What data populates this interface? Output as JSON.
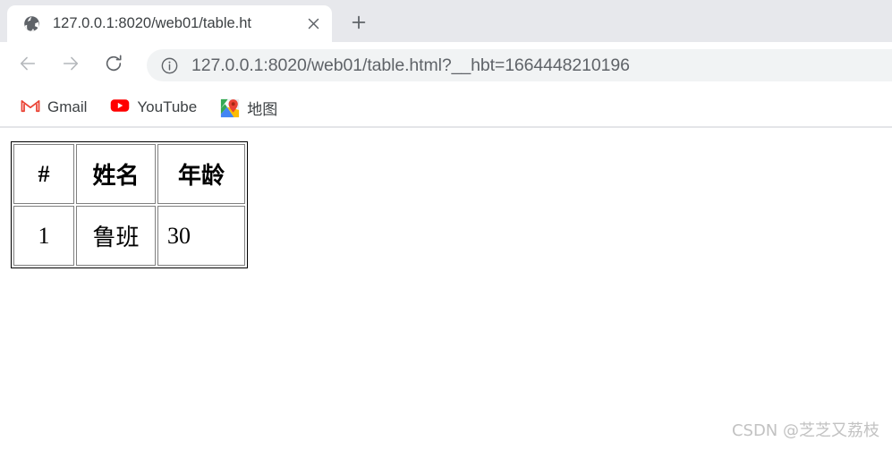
{
  "browser": {
    "tab": {
      "favicon": "globe-icon",
      "title": "127.0.0.1:8020/web01/table.ht",
      "close_label": "×"
    },
    "new_tab_label": "+",
    "toolbar": {
      "back_label": "←",
      "forward_label": "→",
      "reload_label": "↻",
      "site_info_icon": "info-circle-icon",
      "url": "127.0.0.1:8020/web01/table.html?__hbt=1664448210196"
    },
    "bookmarks": [
      {
        "icon": "gmail-icon",
        "label": "Gmail"
      },
      {
        "icon": "youtube-icon",
        "label": "YouTube"
      },
      {
        "icon": "google-maps-icon",
        "label": "地图"
      }
    ]
  },
  "page": {
    "table": {
      "headers": [
        "#",
        "姓名",
        "年龄"
      ],
      "rows": [
        [
          "1",
          "鲁班",
          "30"
        ]
      ]
    }
  },
  "watermark": "CSDN @芝芝又荔枝",
  "colors": {
    "tabstrip_bg": "#e7e8ec",
    "omnibox_bg": "#f1f3f4",
    "text_primary": "#3c4043",
    "text_secondary": "#5f6368",
    "gmail_red": "#ea4335",
    "youtube_red": "#ff0000",
    "maps_green": "#34a853",
    "maps_blue": "#4285f4",
    "maps_yellow": "#fbbc04",
    "table_border": "#808080",
    "watermark": "#c2c2c2"
  }
}
